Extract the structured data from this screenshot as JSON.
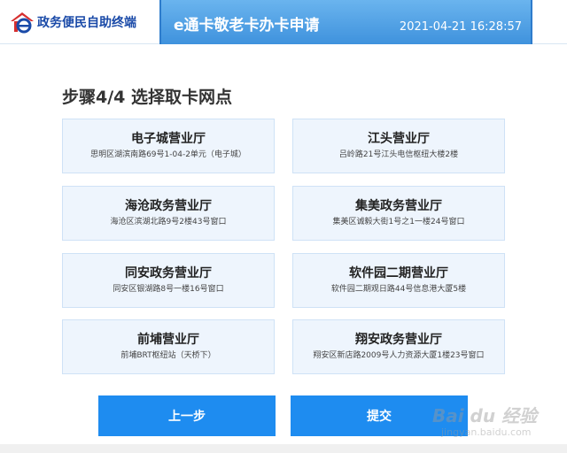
{
  "header": {
    "logo_text": "政务便民自助终端",
    "title": "e通卡敬老卡办卡申请",
    "datetime": "2021-04-21 16:28:57"
  },
  "step_title": "步骤4/4 选择取卡网点",
  "outlets": [
    {
      "name": "电子城营业厅",
      "address": "思明区湖滨南路69号1-04-2单元（电子城）"
    },
    {
      "name": "江头营业厅",
      "address": "吕岭路21号江头电信枢纽大楼2楼"
    },
    {
      "name": "海沧政务营业厅",
      "address": "海沧区滨湖北路9号2楼43号窗口"
    },
    {
      "name": "集美政务营业厅",
      "address": "集美区诚毅大街1号之1一楼24号窗口"
    },
    {
      "name": "同安政务营业厅",
      "address": "同安区银湖路8号一楼16号窗口"
    },
    {
      "name": "软件园二期营业厅",
      "address": "软件园二期观日路44号信息港大厦5楼"
    },
    {
      "name": "前埔营业厅",
      "address": "前埔BRT枢纽站（天桥下）"
    },
    {
      "name": "翔安政务营业厅",
      "address": "翔安区新店路2009号人力资源大厦1楼23号窗口"
    }
  ],
  "buttons": {
    "prev": "上一步",
    "submit": "提交"
  },
  "watermark": {
    "main": "Bai du 经验",
    "sub": "jingyan.baidu.com"
  },
  "colors": {
    "accent": "#1e8cf0",
    "card_bg": "#eef5fd",
    "logo_red": "#d62f2f",
    "logo_blue": "#1a4aa8"
  }
}
